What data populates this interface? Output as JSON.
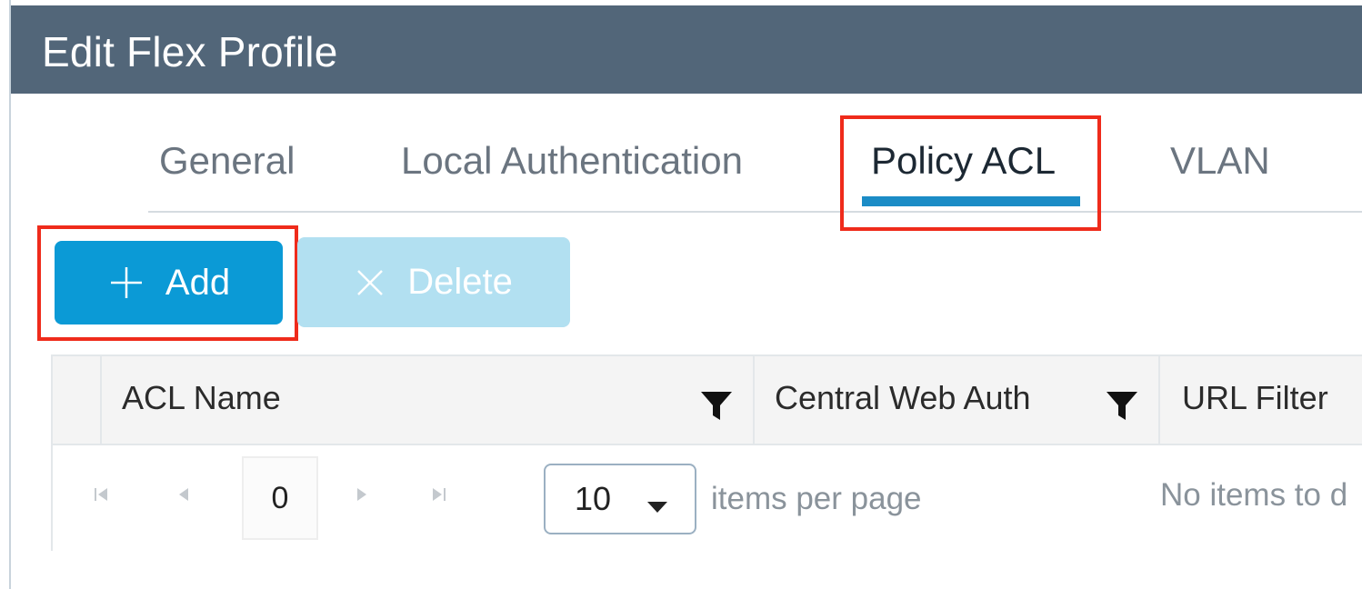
{
  "dialog": {
    "title": "Edit Flex Profile"
  },
  "tabs": [
    {
      "label": "General"
    },
    {
      "label": "Local Authentication"
    },
    {
      "label": "Policy ACL",
      "active": true
    },
    {
      "label": "VLAN"
    }
  ],
  "toolbar": {
    "add_label": "Add",
    "delete_label": "Delete",
    "delete_enabled": false
  },
  "table": {
    "columns": [
      {
        "label": "ACL Name",
        "filter_icon": "filter-icon"
      },
      {
        "label": "Central Web Auth",
        "filter_icon": "filter-icon"
      },
      {
        "label": "URL Filter"
      }
    ],
    "rows": []
  },
  "pager": {
    "current_page": "0",
    "page_size": "10",
    "items_per_page_label": "items per page",
    "status_text": "No items to d"
  },
  "colors": {
    "header_bg": "#526679",
    "accent": "#0b9ad6",
    "tab_underline": "#1b8cc6",
    "highlight": "#ef2b1b"
  }
}
